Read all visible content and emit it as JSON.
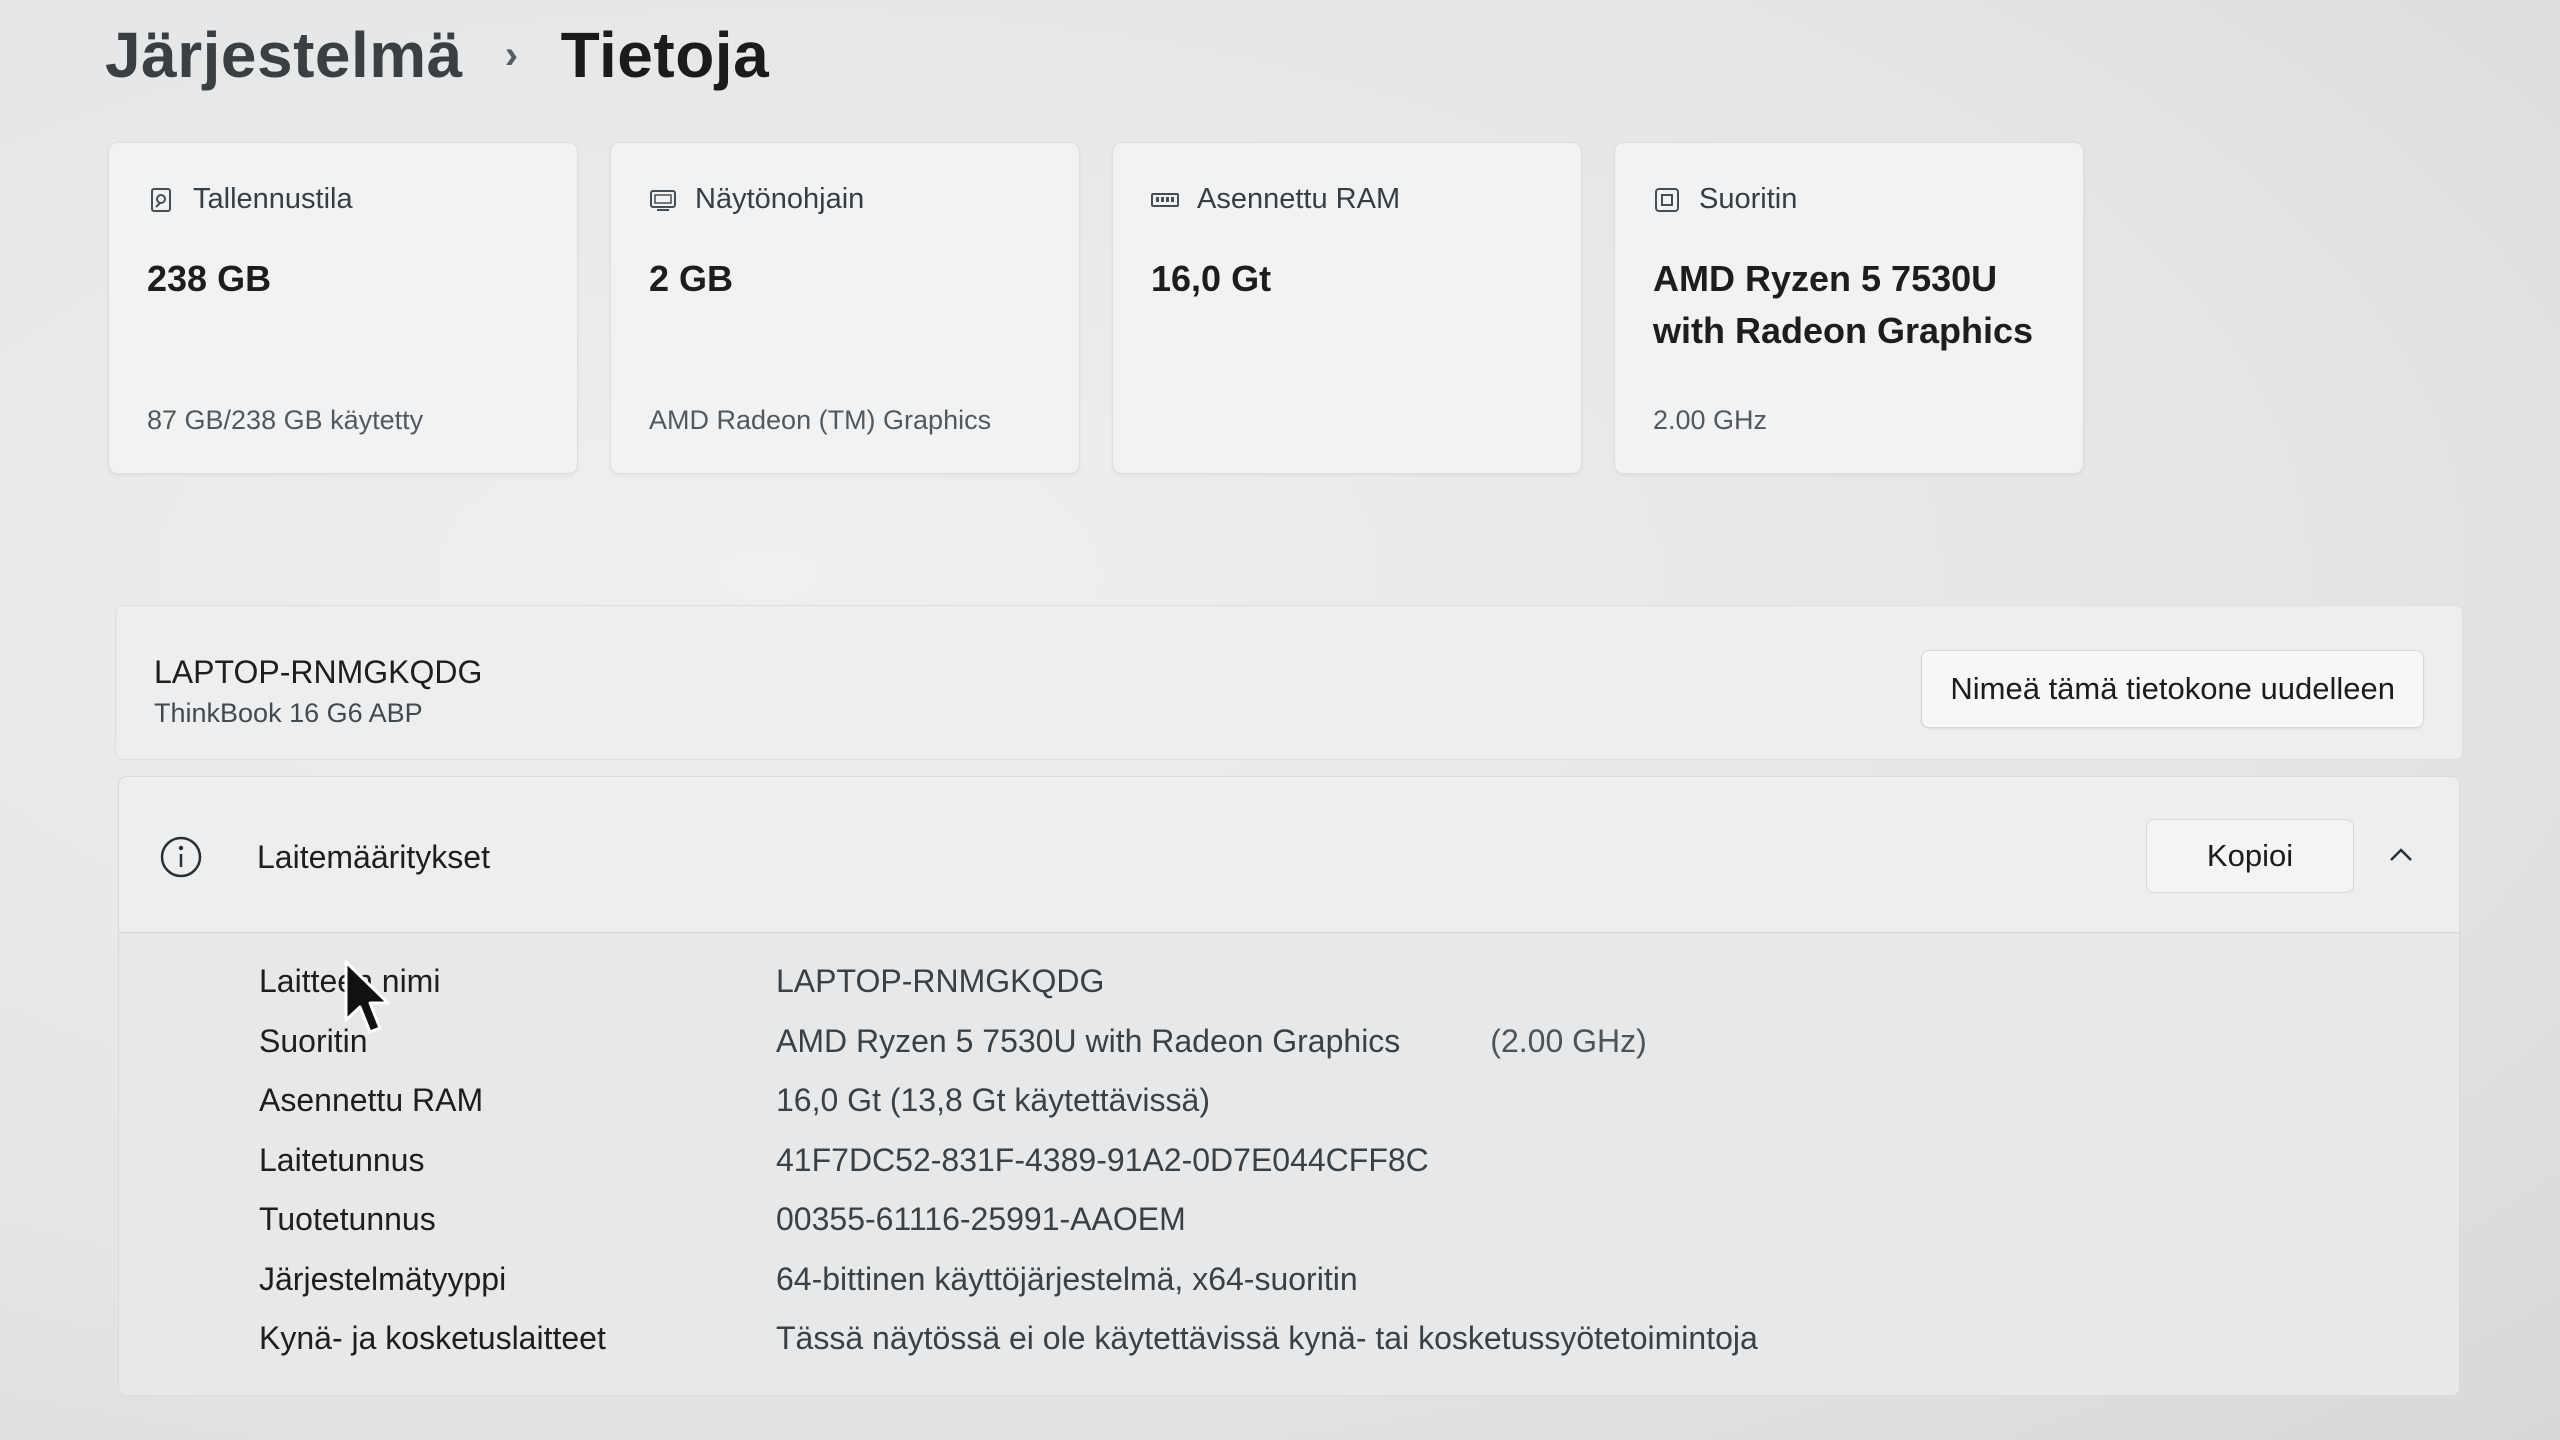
{
  "breadcrumb": {
    "parent": "Järjestelmä",
    "separator": "›",
    "current": "Tietoja"
  },
  "cards": [
    {
      "icon": "storage-icon",
      "title": "Tallennustila",
      "value": "238 GB",
      "sub": "87 GB/238 GB käytetty"
    },
    {
      "icon": "gpu-icon",
      "title": "Näytönohjain",
      "value": "2 GB",
      "sub": "AMD Radeon (TM) Graphics"
    },
    {
      "icon": "ram-icon",
      "title": "Asennettu RAM",
      "value": "16,0 Gt",
      "sub": ""
    },
    {
      "icon": "cpu-icon",
      "title": "Suoritin",
      "value": "AMD Ryzen 5 7530U with Radeon Graphics",
      "sub": "2.00 GHz"
    }
  ],
  "device": {
    "name": "LAPTOP-RNMGKQDG",
    "model": "ThinkBook 16 G6 ABP",
    "rename_label": "Nimeä tämä tietokone uudelleen"
  },
  "specs": {
    "title": "Laitemääritykset",
    "copy_label": "Kopioi",
    "rows": [
      {
        "label": "Laitteen nimi",
        "value": "LAPTOP-RNMGKQDG",
        "extra": ""
      },
      {
        "label": "Suoritin",
        "value": "AMD Ryzen 5 7530U with Radeon Graphics",
        "extra": "(2.00 GHz)"
      },
      {
        "label": "Asennettu RAM",
        "value": "16,0 Gt (13,8 Gt käytettävissä)",
        "extra": ""
      },
      {
        "label": "Laitetunnus",
        "value": "41F7DC52-831F-4389-91A2-0D7E044CFF8C",
        "extra": ""
      },
      {
        "label": "Tuotetunnus",
        "value": "00355-61116-25991-AAOEM",
        "extra": ""
      },
      {
        "label": "Järjestelmätyyppi",
        "value": "64-bittinen käyttöjärjestelmä, x64-suoritin",
        "extra": ""
      },
      {
        "label": "Kynä- ja kosketuslaitteet",
        "value": "Tässä näytössä ei ole käytettävissä kynä- tai kosketussyötetoimintoja",
        "extra": ""
      }
    ]
  }
}
